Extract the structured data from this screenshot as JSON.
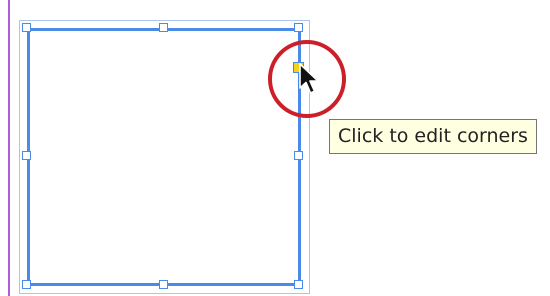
{
  "tooltip": {
    "text": "Click to edit corners"
  },
  "colors": {
    "frame_stroke": "#4a8ae8",
    "outer_bounds": "#a9c7f3",
    "corner_handle_fill": "#f4d21a",
    "highlight_circle": "#cc1f2a",
    "page_edge": "#b15bd6",
    "tooltip_bg": "#ffffe1"
  },
  "icons": {
    "cursor": "arrow-cursor-icon",
    "corner_handle": "live-corner-handle-icon"
  }
}
